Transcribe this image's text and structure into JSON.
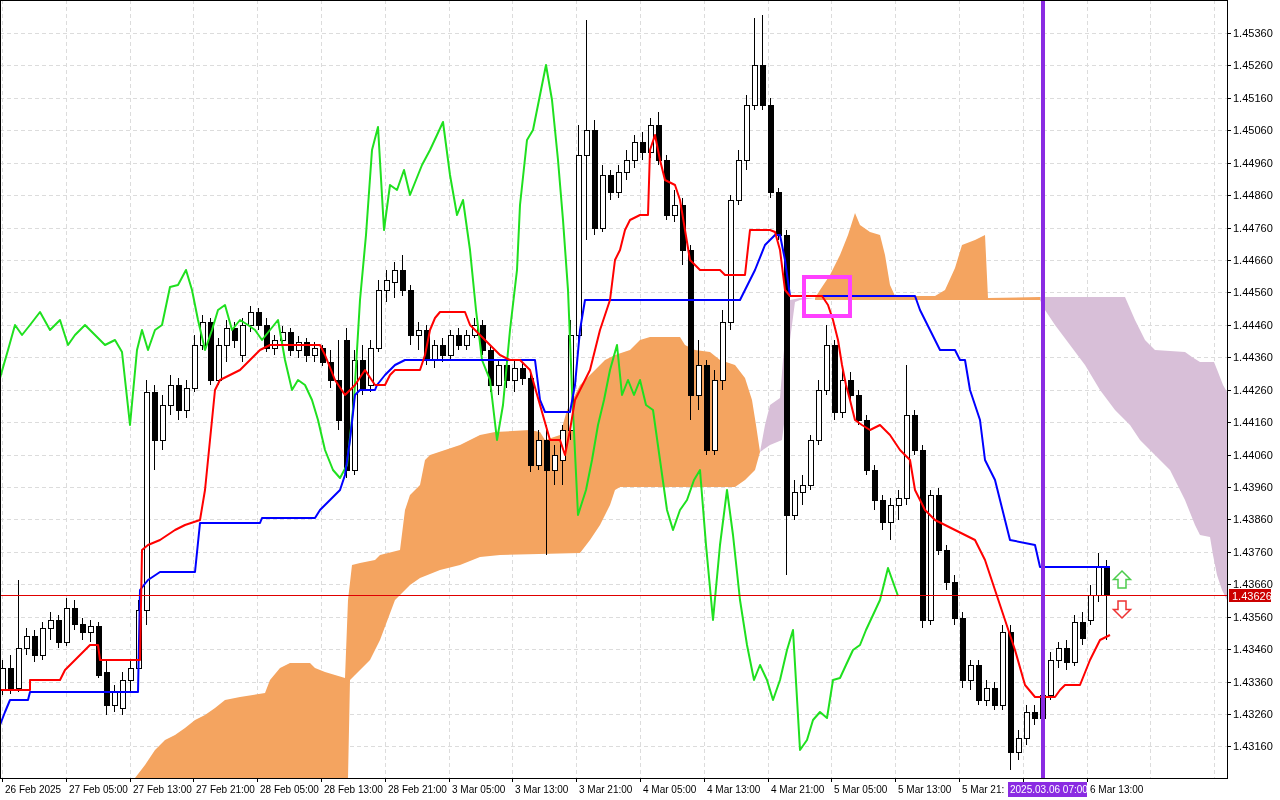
{
  "chart": {
    "price_axis": {
      "labels": [
        "1.45360",
        "1.45260",
        "1.45160",
        "1.45060",
        "1.44960",
        "1.44860",
        "1.44760",
        "1.44660",
        "1.44560",
        "1.44460",
        "1.44360",
        "1.44260",
        "1.44160",
        "1.44060",
        "1.43960",
        "1.43860",
        "1.43760",
        "1.43660",
        "1.43560",
        "1.43460",
        "1.43360",
        "1.43260",
        "1.43160"
      ]
    },
    "time_axis": {
      "labels": [
        "26 Feb 2025",
        "27 Feb 05:00",
        "27 Feb 13:00",
        "27 Feb 21:00",
        "28 Feb 05:00",
        "28 Feb 13:00",
        "28 Feb 21:00",
        "3 Mar 05:00",
        "3 Mar 13:00",
        "3 Mar 21:00",
        "4 Mar 05:00",
        "4 Mar 13:00",
        "4 Mar 21:00",
        "5 Mar 05:00",
        "5 Mar 13:00",
        "5 Mar 21:",
        "6 Mar 13:00"
      ]
    },
    "current_price": {
      "label": "1.43626"
    },
    "time_marker": {
      "label": "2025.03.06 07:00"
    }
  }
}
